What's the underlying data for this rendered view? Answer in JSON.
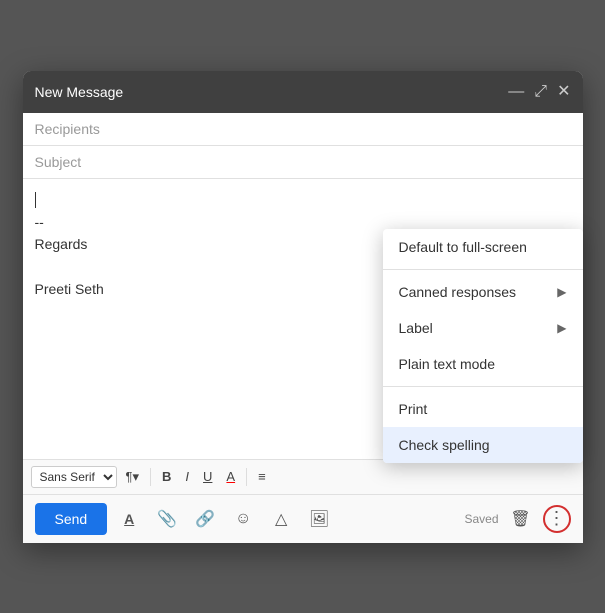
{
  "titleBar": {
    "title": "New Message",
    "minimizeIcon": "—",
    "expandIcon": "⤢",
    "closeIcon": "✕"
  },
  "fields": {
    "recipientsPlaceholder": "Recipients",
    "subjectPlaceholder": "Subject"
  },
  "body": {
    "cursorLine": true,
    "line1": "--",
    "line2": "Regards",
    "line3": "",
    "line4": "Preeti Seth"
  },
  "toolbar": {
    "fontFamily": "Sans Serif",
    "fontSizeIcon": "¶",
    "boldLabel": "B",
    "italicLabel": "I",
    "underlineLabel": "U",
    "fontColorLabel": "A",
    "alignLabel": "≡"
  },
  "bottomBar": {
    "sendLabel": "Send",
    "formatIcon": "A",
    "attachIcon": "📎",
    "linkIcon": "🔗",
    "emojiIcon": "☺",
    "driveIcon": "△",
    "photoIcon": "🖼",
    "savedText": "Saved",
    "deleteIcon": "🗑",
    "moreIcon": "⋮"
  },
  "dropdownMenu": {
    "items": [
      {
        "label": "Default to full-screen",
        "hasArrow": false,
        "highlighted": false
      },
      {
        "label": "Canned responses",
        "hasArrow": true,
        "highlighted": false
      },
      {
        "label": "Label",
        "hasArrow": true,
        "highlighted": false
      },
      {
        "label": "Plain text mode",
        "hasArrow": false,
        "highlighted": false
      },
      {
        "label": "Print",
        "hasArrow": false,
        "highlighted": false
      },
      {
        "label": "Check spelling",
        "hasArrow": false,
        "highlighted": true
      }
    ]
  }
}
